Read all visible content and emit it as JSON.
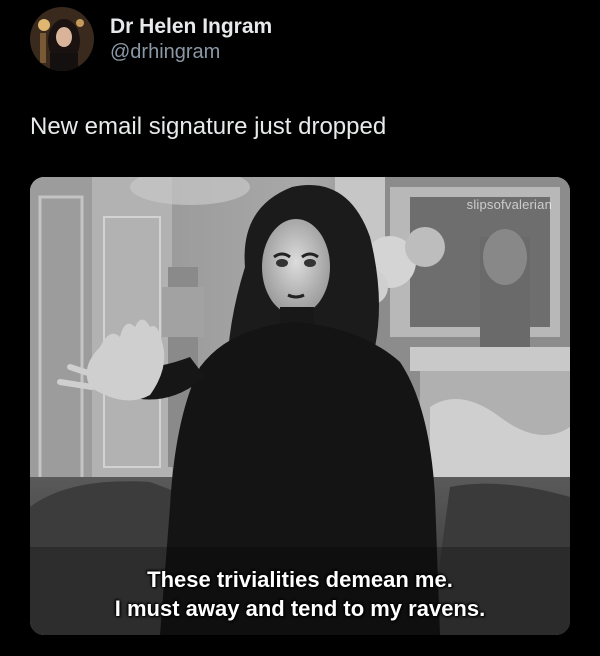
{
  "tweet": {
    "author_name": "Dr Helen Ingram",
    "author_handle": "@drhingram",
    "text": "New email signature just dropped"
  },
  "media": {
    "watermark": "slipsofvalerian",
    "subtitle_line1": "These trivialities demean me.",
    "subtitle_line2": "I must away and tend to my ravens."
  },
  "colors": {
    "background": "#000000",
    "primary_text": "#e7e9ea",
    "secondary_text": "#8b98a5"
  },
  "icons": [
    "avatar"
  ]
}
